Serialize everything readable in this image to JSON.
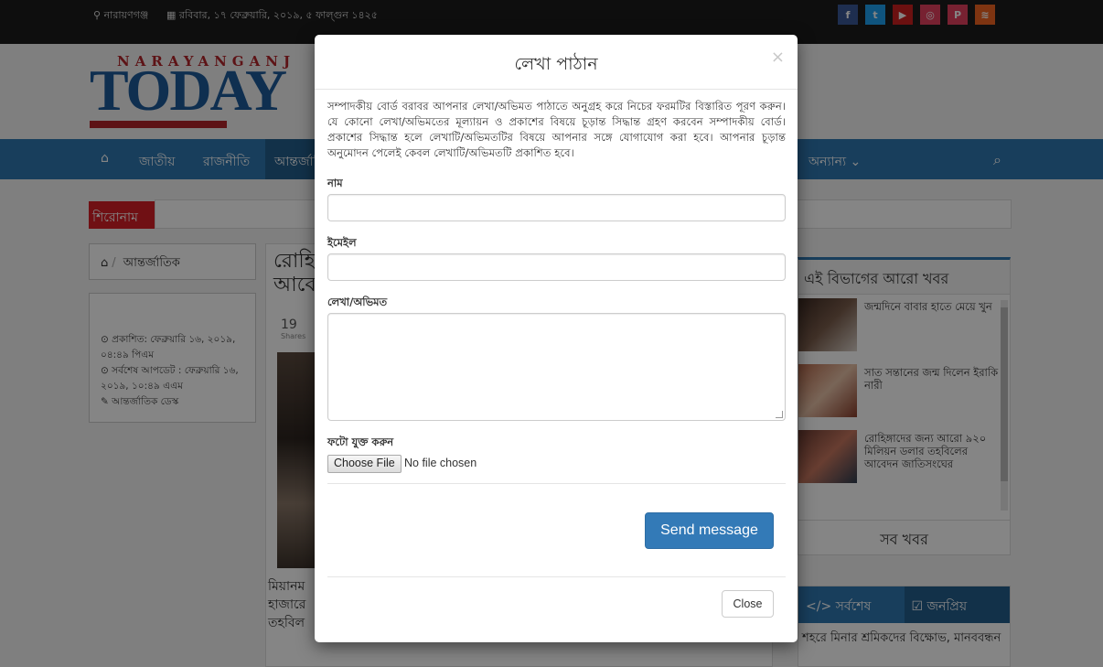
{
  "topbar": {
    "location": "নারায়ণগঞ্জ",
    "date": "রবিবার, ১৭ ফেব্রুয়ারি, ২০১৯, ৫ ফাল্গুন ১৪২৫",
    "social": [
      {
        "icon": "facebook-icon",
        "glyph": "f",
        "color": "#3b5998"
      },
      {
        "icon": "twitter-icon",
        "glyph": "t",
        "color": "#1da1f2"
      },
      {
        "icon": "youtube-icon",
        "glyph": "▶",
        "color": "#cd201f"
      },
      {
        "icon": "instagram-icon",
        "glyph": "◎",
        "color": "#e4405f"
      },
      {
        "icon": "pinterest-icon",
        "glyph": "P",
        "color": "#e4405f"
      },
      {
        "icon": "rss-icon",
        "glyph": "≋",
        "color": "#f26522"
      }
    ]
  },
  "logo": {
    "top": "NARAYANGANJ",
    "main": "TODAY"
  },
  "nav": {
    "home_icon": "home-icon",
    "items": [
      "জাতীয়",
      "রাজনীতি",
      "আন্তর্জাতিক"
    ],
    "more": "অন্যান্য ⌄",
    "search_icon": "search-icon"
  },
  "headline": {
    "label": "শিরোনাম"
  },
  "breadcrumb": {
    "label": "আন্তর্জাতিক"
  },
  "meta": {
    "published": "প্রকাশিত: ফেব্রুয়ারি ১৬, ২০১৯, ০৪:৪৯ পিএম",
    "updated": "সর্বশেষ আপডেট : ফেব্রুয়ারি ১৬, ২০১৯, ১০:৪৯ এএম",
    "author": "আন্তর্জাতিক ডেস্ক"
  },
  "article": {
    "title_line1": "রোহি",
    "title_line2": "আবে",
    "shares_count": "19",
    "shares_label": "Shares",
    "body_line1": "মিয়ানম",
    "body_line2": "হাজারে",
    "body_line3": "তহবিল"
  },
  "sidebar": {
    "title": "এই বিভাগের আরো খবর",
    "items": [
      {
        "text": "জন্মদিনে বাবার হাতে মেয়ে খুন"
      },
      {
        "text": "সাত সন্তানের জন্ম দিলেন ইরাকি নারী"
      },
      {
        "text": "রোহিঙ্গাদের জন্য আরো ৯২০ মিলিয়ন ডলার তহবিলের আবেদন জাতিসংঘের"
      }
    ],
    "all_news": "সব খবর"
  },
  "tabs": {
    "latest": "</>  সর্বশেষ",
    "popular": "জনপ্রিয়",
    "first_item": "শহরে মিনার শ্রমিকদের বিক্ষোভ, মানববন্ধন"
  },
  "modal": {
    "title": "লেখা পাঠান",
    "close_glyph": "×",
    "intro": "সম্পাদকীয় বোর্ড বরাবর আপনার লেখা/অভিমত পাঠাতে অনুগ্রহ করে নিচের ফরমটির বিস্তারিত পূরণ করুন। যে কোনো লেখা/অভিমতের মূল্যায়ন ও প্রকাশের বিষয়ে চূড়ান্ত সিদ্ধান্ত গ্রহণ করবেন সম্পাদকীয় বোর্ড। প্রকাশের সিদ্ধান্ত হলে লেখাটি/অভিমতটির বিষয়ে আপনার সঙ্গে যোগাযোগ করা হবে। আপনার চূড়ান্ত অনুমোদন পেলেই কেবল লেখাটি/অভিমতটি প্রকাশিত হবে।",
    "name_label": "নাম",
    "name_value": "",
    "email_label": "ইমেইল",
    "email_value": "",
    "message_label": "লেখা/অভিমত",
    "message_value": "",
    "photo_label": "ফটো যুক্ত করুন",
    "file_button": "Choose File",
    "file_status": "No file chosen",
    "send_button": "Send message",
    "close_button": "Close"
  }
}
